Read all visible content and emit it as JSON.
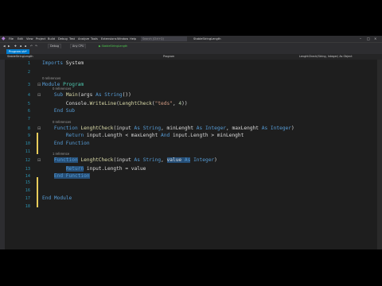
{
  "menu": {
    "items": [
      "File",
      "Edit",
      "View",
      "Project",
      "Build",
      "Debug",
      "Test",
      "Analyze",
      "Tools",
      "Extensions",
      "Window",
      "Help"
    ],
    "search_placeholder": "Search (Ctrl+Q)",
    "project_title": "StableStringLength"
  },
  "toolbar": {
    "config": "Debug",
    "platform": "Any CPU",
    "start_label": "▶ StableStringLength"
  },
  "tabs": [
    {
      "label": "Program.vb*"
    }
  ],
  "navbar": {
    "project": "StableStringLength",
    "class": "Program",
    "member": "LenghtCheck(String, Integer) As Object"
  },
  "editor": {
    "lines": [
      {
        "n": "1",
        "tokens": [
          {
            "t": "Imports",
            "c": "kw"
          },
          {
            "t": " System",
            "c": "pl"
          }
        ]
      },
      {
        "n": "2",
        "tokens": []
      },
      {
        "n": "3",
        "lens": "0 references",
        "fold": "⊟",
        "tokens": [
          {
            "t": "Module",
            "c": "kw"
          },
          {
            "t": " ",
            "c": "pl"
          },
          {
            "t": "Program",
            "c": "ty"
          }
        ]
      },
      {
        "n": "4",
        "lens": "0 references",
        "fold": "⊟",
        "tokens": [
          {
            "t": "    ",
            "c": "pl"
          },
          {
            "t": "Sub",
            "c": "kw"
          },
          {
            "t": " ",
            "c": "pl"
          },
          {
            "t": "Main",
            "c": "fn"
          },
          {
            "t": "(args ",
            "c": "pl"
          },
          {
            "t": "As",
            "c": "kw"
          },
          {
            "t": " ",
            "c": "pl"
          },
          {
            "t": "String",
            "c": "kw"
          },
          {
            "t": "())",
            "c": "pl"
          }
        ]
      },
      {
        "n": "5",
        "tokens": [
          {
            "t": "        Console.",
            "c": "pl"
          },
          {
            "t": "WriteLine",
            "c": "fn"
          },
          {
            "t": "(",
            "c": "pl"
          },
          {
            "t": "LenghtCheck",
            "c": "fn"
          },
          {
            "t": "(",
            "c": "pl"
          },
          {
            "t": "\"teds\"",
            "c": "st"
          },
          {
            "t": ", ",
            "c": "pl"
          },
          {
            "t": "4",
            "c": "nu"
          },
          {
            "t": "))",
            "c": "pl"
          }
        ]
      },
      {
        "n": "6",
        "tokens": [
          {
            "t": "    ",
            "c": "pl"
          },
          {
            "t": "End Sub",
            "c": "kw"
          }
        ]
      },
      {
        "n": "7",
        "tokens": []
      },
      {
        "n": "8",
        "lens": "0 references",
        "fold": "⊟",
        "tokens": [
          {
            "t": "    ",
            "c": "pl"
          },
          {
            "t": "Function",
            "c": "kw"
          },
          {
            "t": " ",
            "c": "pl"
          },
          {
            "t": "LenghtCheck",
            "c": "fn"
          },
          {
            "t": "(input ",
            "c": "pl"
          },
          {
            "t": "As",
            "c": "kw"
          },
          {
            "t": " ",
            "c": "pl"
          },
          {
            "t": "String",
            "c": "kw"
          },
          {
            "t": ", minLenght ",
            "c": "pl"
          },
          {
            "t": "As",
            "c": "kw"
          },
          {
            "t": " ",
            "c": "pl"
          },
          {
            "t": "Integer",
            "c": "kw"
          },
          {
            "t": ", maxLenght ",
            "c": "pl"
          },
          {
            "t": "As",
            "c": "kw"
          },
          {
            "t": " ",
            "c": "pl"
          },
          {
            "t": "Integer",
            "c": "kw"
          },
          {
            "t": ")",
            "c": "pl"
          }
        ]
      },
      {
        "n": "9",
        "tokens": [
          {
            "t": "        ",
            "c": "pl"
          },
          {
            "t": "Return",
            "c": "kw"
          },
          {
            "t": " input.Length < maxLenght ",
            "c": "pl"
          },
          {
            "t": "And",
            "c": "kw"
          },
          {
            "t": " input.Length > minLenght",
            "c": "pl"
          }
        ]
      },
      {
        "n": "10",
        "tokens": [
          {
            "t": "    ",
            "c": "pl"
          },
          {
            "t": "End Function",
            "c": "kw"
          }
        ]
      },
      {
        "n": "11",
        "tokens": []
      },
      {
        "n": "12",
        "lens": "1 reference",
        "fold": "⊟",
        "tokens": [
          {
            "t": "    ",
            "c": "pl"
          },
          {
            "t": "Function",
            "c": "kw hl"
          },
          {
            "t": " ",
            "c": "pl"
          },
          {
            "t": "LenghtCheck",
            "c": "fn"
          },
          {
            "t": "(input ",
            "c": "pl"
          },
          {
            "t": "As",
            "c": "kw"
          },
          {
            "t": " ",
            "c": "pl"
          },
          {
            "t": "String",
            "c": "kw"
          },
          {
            "t": ", ",
            "c": "pl"
          },
          {
            "t": "value",
            "c": "pl hl"
          },
          {
            "t": " ",
            "c": "pl hl"
          },
          {
            "t": "As",
            "c": "kw hl"
          },
          {
            "t": " ",
            "c": "pl"
          },
          {
            "t": "Integer",
            "c": "kw"
          },
          {
            "t": ")",
            "c": "pl"
          }
        ]
      },
      {
        "n": "13",
        "tokens": [
          {
            "t": "        ",
            "c": "pl"
          },
          {
            "t": "Return",
            "c": "kw hl"
          },
          {
            "t": " input.Length = value",
            "c": "pl"
          }
        ]
      },
      {
        "n": "14",
        "tokens": [
          {
            "t": "    ",
            "c": "pl"
          },
          {
            "t": "End Function",
            "c": "kw hl"
          }
        ]
      },
      {
        "n": "15",
        "tokens": []
      },
      {
        "n": "16",
        "tokens": []
      },
      {
        "n": "17",
        "tokens": [
          {
            "t": "End Module",
            "c": "kw"
          }
        ]
      },
      {
        "n": "18",
        "tokens": []
      }
    ]
  },
  "colors": {
    "accent": "#007acc",
    "keyword": "#569cd6",
    "type": "#4ec9b0",
    "function": "#dcdcaa",
    "string": "#d69d85",
    "number": "#b5cea8",
    "line_number": "#2b91af",
    "change_marker": "#e8cc5a"
  }
}
